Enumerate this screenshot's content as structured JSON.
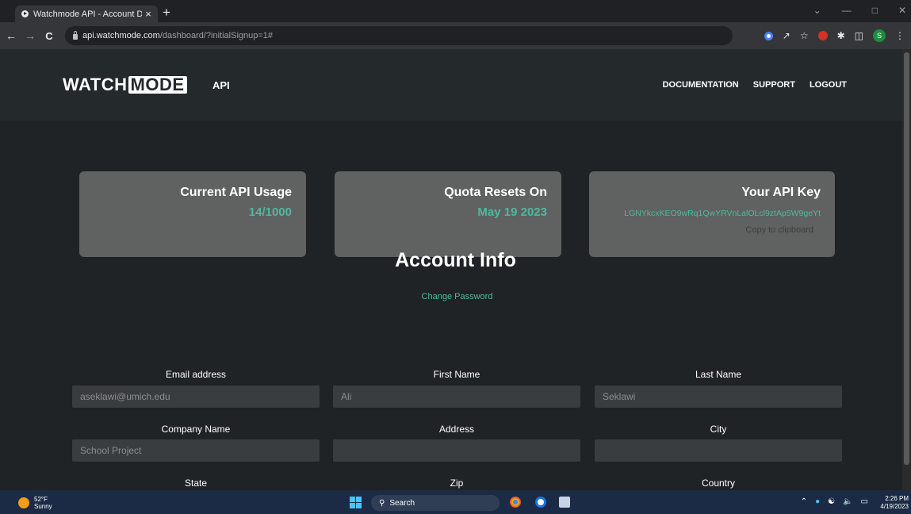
{
  "browser": {
    "tab_title": "Watchmode API - Account Dashb",
    "tab_close": "×",
    "new_tab": "+",
    "url_host": "api.watchmode.com",
    "url_path": "/dashboard/?initialSignup=1#",
    "back": "←",
    "forward": "→",
    "reload": "C",
    "profile_initial": "S"
  },
  "header": {
    "logo_watch": "WATCH",
    "logo_mode": "MODE",
    "api_label": "API",
    "nav": [
      "DOCUMENTATION",
      "SUPPORT",
      "LOGOUT"
    ]
  },
  "cards": {
    "usage_title": "Current API Usage",
    "usage_value": "14/1000",
    "quota_title": "Quota Resets On",
    "quota_value": "May 19 2023",
    "key_title": "Your API Key",
    "key_value": "LGNYkcxKEO9wRq1QwYRVnLalOLcl9ztAp5W9geYt",
    "copy_label": "Copy to clipboard"
  },
  "account": {
    "title": "Account Info",
    "change_password": "Change Password",
    "fields": {
      "email": {
        "label": "Email address",
        "value": "aseklawi@umich.edu"
      },
      "first_name": {
        "label": "First Name",
        "value": "Ali"
      },
      "last_name": {
        "label": "Last Name",
        "value": "Seklawi"
      },
      "company": {
        "label": "Company Name",
        "value": "School Project"
      },
      "address": {
        "label": "Address",
        "value": ""
      },
      "city": {
        "label": "City",
        "value": ""
      },
      "state": {
        "label": "State"
      },
      "zip": {
        "label": "Zip"
      },
      "country": {
        "label": "Country"
      }
    }
  },
  "taskbar": {
    "temperature": "52°F",
    "weather": "Sunny",
    "search_label": "Search",
    "time": "2:26 PM",
    "date": "4/19/2023"
  },
  "colors": {
    "accent": "#4fb8a0",
    "card_bg": "#5f6260",
    "page_bg": "#1f2325"
  }
}
